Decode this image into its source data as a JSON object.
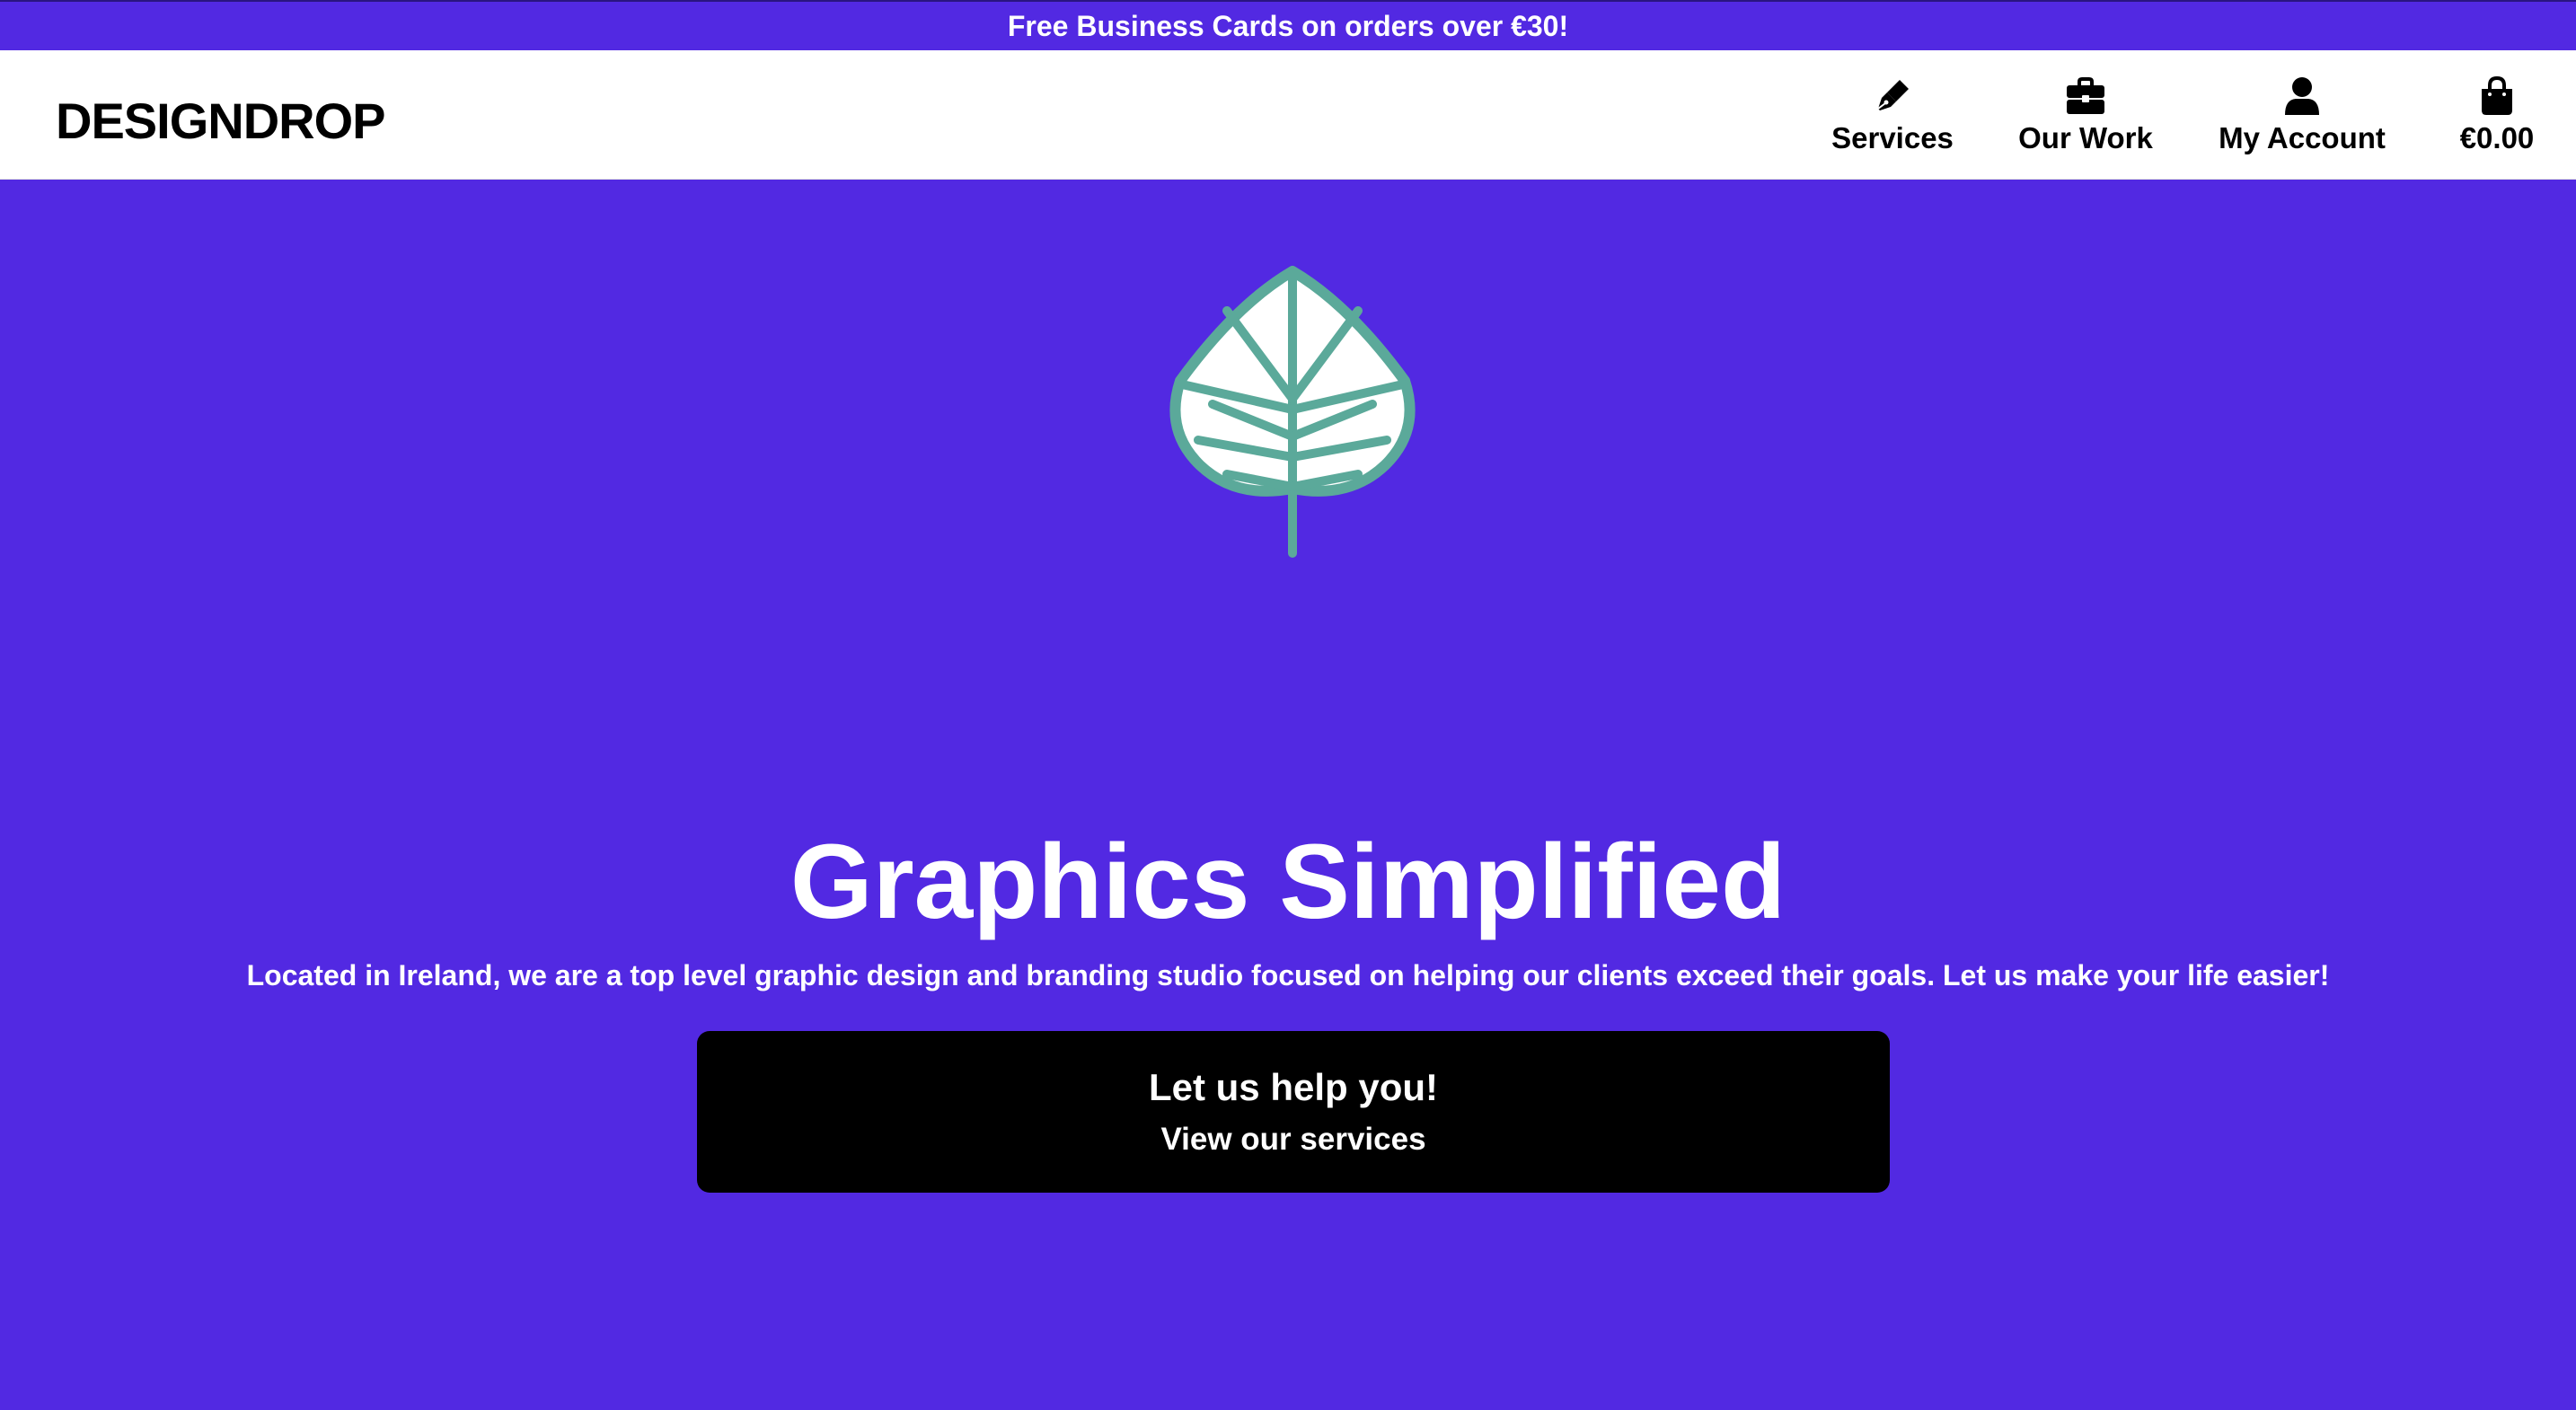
{
  "promo": {
    "text": "Free Business Cards on orders over €30!"
  },
  "header": {
    "logo": "DESIGNDROP",
    "nav": [
      {
        "label": "Services",
        "icon": "pen-nib-icon"
      },
      {
        "label": "Our Work",
        "icon": "briefcase-icon"
      },
      {
        "label": "My Account",
        "icon": "user-icon"
      },
      {
        "label": "€0.00",
        "icon": "shopping-bag-icon"
      }
    ]
  },
  "hero": {
    "logo_icon": "leaf-icon",
    "title": "Graphics Simplified",
    "subtitle": "Located in Ireland, we are a top level graphic design and branding studio focused on helping our clients exceed their goals. Let us make your life easier!",
    "cta": {
      "line1": "Let us help you!",
      "line2": "View our services"
    }
  },
  "colors": {
    "brand_purple": "#5229E2",
    "leaf_teal": "#5BA99A",
    "cta_background": "#000000"
  }
}
